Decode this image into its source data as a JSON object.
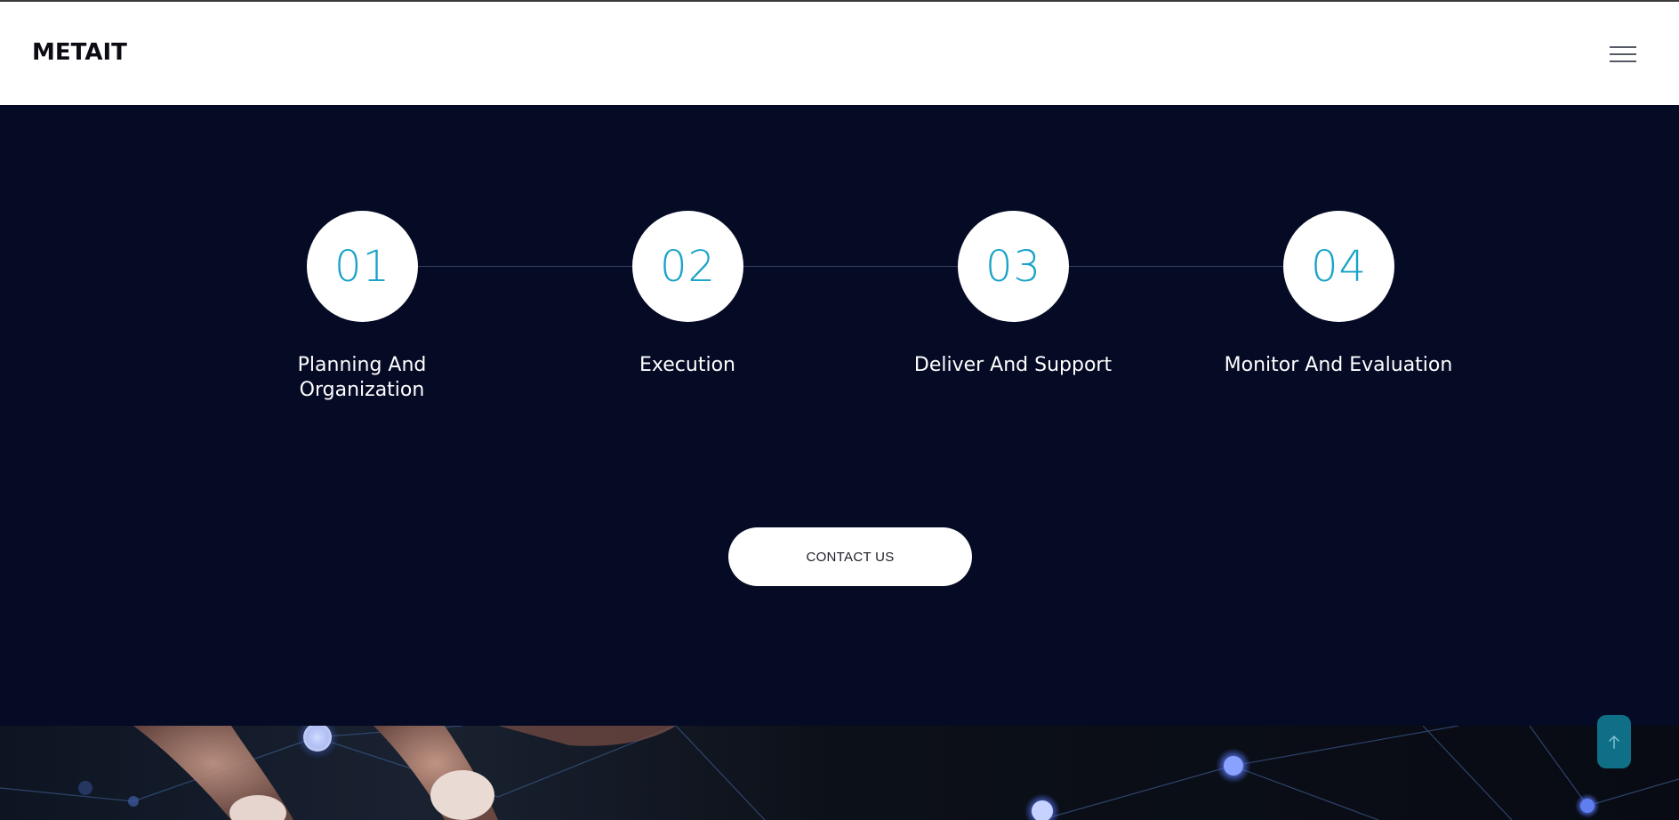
{
  "header": {
    "logo_text": "METAIT",
    "menu_icon": "hamburger-menu-icon"
  },
  "process": {
    "steps": [
      {
        "number": "01",
        "label": "Planning And Organization"
      },
      {
        "number": "02",
        "label": "Execution"
      },
      {
        "number": "03",
        "label": "Deliver And Support"
      },
      {
        "number": "04",
        "label": "Monitor And Evaluation"
      }
    ],
    "contact_label": "CONTACT US"
  },
  "scroll_top": {
    "icon": "arrow-up-icon"
  },
  "colors": {
    "dark_navy": "#050a25",
    "accent_cyan": "#1aa3c8",
    "scroll_button": "#0f6f86"
  }
}
